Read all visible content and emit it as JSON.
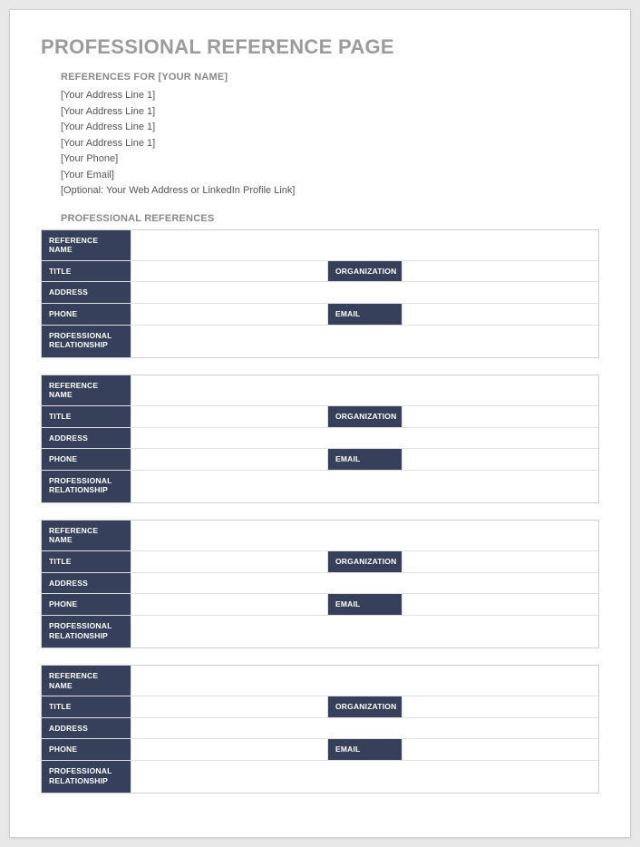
{
  "title": "PROFESSIONAL REFERENCE PAGE",
  "references_for_label": "REFERENCES FOR [YOUR NAME]",
  "address_lines": [
    "[Your Address Line 1]",
    "[Your Address Line 1]",
    "[Your Address Line 1]",
    "[Your Address Line 1]",
    "[Your Phone]",
    "[Your Email]",
    "[Optional: Your Web Address or LinkedIn Profile Link]"
  ],
  "professional_references_label": "PROFESSIONAL REFERENCES",
  "row_labels": {
    "reference_name": "REFERENCE NAME",
    "title": "TITLE",
    "organization": "ORGANIZATION",
    "address": "ADDRESS",
    "phone": "PHONE",
    "email": "EMAIL",
    "professional_relationship": "PROFESSIONAL RELATIONSHIP"
  },
  "references": [
    {
      "reference_name": "",
      "title": "",
      "organization": "",
      "address": "",
      "phone": "",
      "email": "",
      "professional_relationship": ""
    },
    {
      "reference_name": "",
      "title": "",
      "organization": "",
      "address": "",
      "phone": "",
      "email": "",
      "professional_relationship": ""
    },
    {
      "reference_name": "",
      "title": "",
      "organization": "",
      "address": "",
      "phone": "",
      "email": "",
      "professional_relationship": ""
    },
    {
      "reference_name": "",
      "title": "",
      "organization": "",
      "address": "",
      "phone": "",
      "email": "",
      "professional_relationship": ""
    }
  ]
}
